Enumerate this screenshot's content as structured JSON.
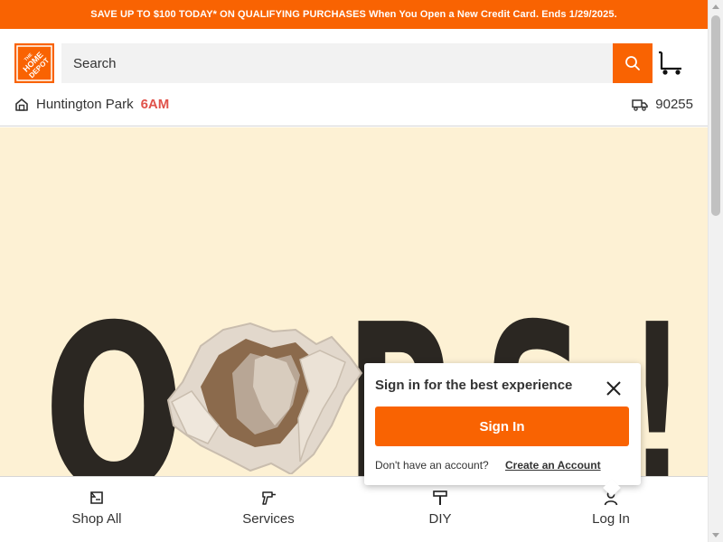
{
  "promo": {
    "text": "SAVE UP TO $100 TODAY* ON QUALIFYING PURCHASES When You Open a New Credit Card. Ends 1/29/2025."
  },
  "header": {
    "logo_text": "THE HOME DEPOT",
    "search_placeholder": "Search"
  },
  "store": {
    "name": "Huntington Park",
    "time": "6AM",
    "zip": "90255"
  },
  "hero": {
    "letters": [
      "O",
      "P",
      "S",
      "!"
    ]
  },
  "popup": {
    "title": "Sign in for the best experience",
    "signin_label": "Sign In",
    "question": "Don't have an account?",
    "create_label": "Create an Account"
  },
  "bottom_nav": {
    "items": [
      {
        "label": "Shop All",
        "icon": "shop-all-icon"
      },
      {
        "label": "Services",
        "icon": "drill-icon"
      },
      {
        "label": "DIY",
        "icon": "hammer-icon"
      },
      {
        "label": "Log In",
        "icon": "user-icon"
      }
    ]
  },
  "colors": {
    "brand": "#f96302",
    "hero_bg": "#fdf1d4",
    "hero_text": "#2b2722",
    "store_time": "#e0524a"
  }
}
